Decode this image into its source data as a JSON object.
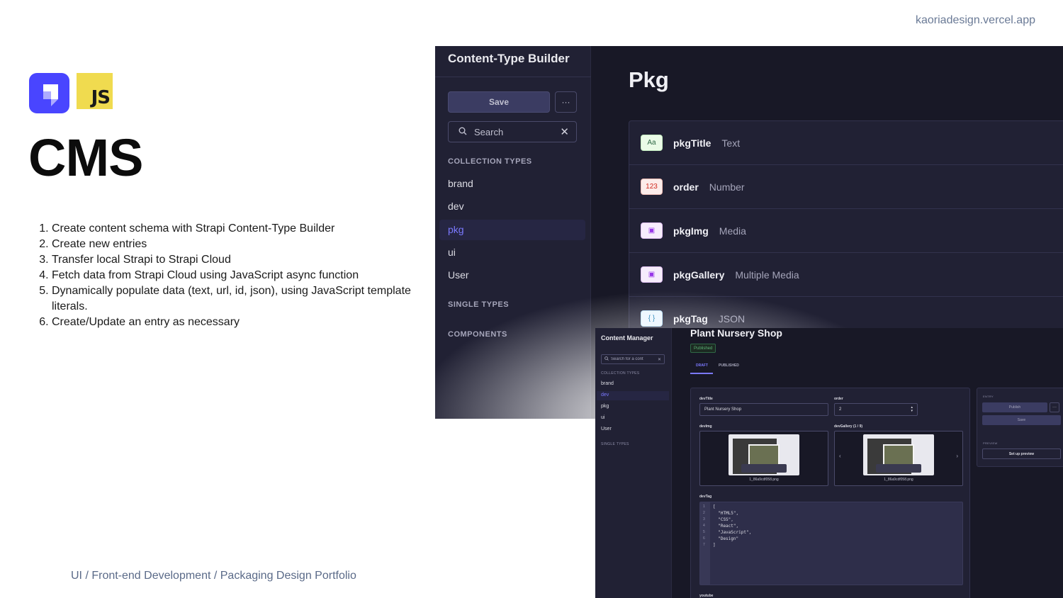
{
  "site_url": "kaoriadesign.vercel.app",
  "logos": {
    "js_label": "JS"
  },
  "title": "CMS",
  "steps": [
    "Create content schema with Strapi Content-Type Builder",
    "Create new entries",
    "Transfer local Strapi to Strapi Cloud",
    "Fetch data from Strapi Cloud using JavaScript async function",
    "Dynamically populate data (text, url, id, json), using JavaScript template literals.",
    "Create/Update an entry as necessary"
  ],
  "footer": "UI / Front-end Development / Packaging Design Portfolio",
  "content_type_builder": {
    "title": "Content-Type Builder",
    "save_label": "Save",
    "more_label": "···",
    "search_placeholder": "Search",
    "collection_types_label": "COLLECTION TYPES",
    "collection_types": [
      "brand",
      "dev",
      "pkg",
      "ui",
      "User"
    ],
    "active_item": "pkg",
    "single_types_label": "SINGLE TYPES",
    "components_label": "COMPONENTS",
    "main_title": "Pkg",
    "fields": [
      {
        "icon": "Aa",
        "icon_kind": "text-icon",
        "name": "pkgTitle",
        "type": "Text"
      },
      {
        "icon": "123",
        "icon_kind": "number-icon",
        "name": "order",
        "type": "Number"
      },
      {
        "icon": "▣",
        "icon_kind": "media-icon",
        "name": "pkgImg",
        "type": "Media"
      },
      {
        "icon": "▣",
        "icon_kind": "media-icon",
        "name": "pkgGallery",
        "type": "Multiple Media"
      },
      {
        "icon": "{ }",
        "icon_kind": "json-icon",
        "name": "pkgTag",
        "type": "JSON"
      }
    ],
    "colors": {
      "accent": "#7b79ff",
      "background": "#181826",
      "sidebar": "#212134"
    }
  },
  "content_manager": {
    "title": "Content Manager",
    "search_placeholder": "Search for a cont",
    "collection_types_label": "COLLECTION TYPES",
    "collection_types": [
      "brand",
      "dev",
      "pkg",
      "ui",
      "User"
    ],
    "active_item": "dev",
    "single_types_label": "SINGLE TYPES",
    "entry_title": "Plant Nursery Shop",
    "status_badge": "Published",
    "tabs": [
      "DRAFT",
      "PUBLISHED"
    ],
    "active_tab": "DRAFT",
    "fields": {
      "devTitle_label": "devTitle",
      "devTitle_value": "Plant Nursery Shop",
      "order_label": "order",
      "order_value": "2",
      "devImg_label": "devImg",
      "devImg_file": "1_86a9cdf058.png",
      "devGallery_label": "devGallery (1 / 9)",
      "devGallery_file": "1_86a9cdf058.png",
      "devTag_label": "devTag",
      "devTag_lines": [
        "[",
        "  \"HTML5\",",
        "  \"CSS\",",
        "  \"React\",",
        "  \"JavaScript\",",
        "  \"Design\"",
        "]"
      ],
      "youtube_label": "youtube"
    },
    "entry_panel": {
      "section_label": "ENTRY",
      "publish_label": "Publish",
      "more_label": "···",
      "save_label": "Save",
      "preview_section_label": "PREVIEW",
      "preview_button": "Set up preview"
    }
  }
}
